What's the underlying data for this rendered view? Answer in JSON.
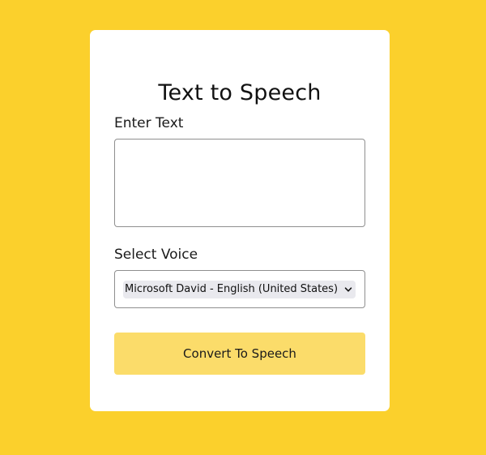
{
  "app": {
    "title": "Text to Speech"
  },
  "form": {
    "text_label": "Enter Text",
    "text_value": "",
    "voice_label": "Select Voice",
    "voice_selected": "Microsoft David - English (United States)",
    "convert_label": "Convert To Speech"
  },
  "colors": {
    "background": "#fbd02c",
    "card": "#ffffff",
    "button": "#fbdc6a",
    "border": "#8f8f8f"
  },
  "icons": {
    "select_arrow": "chevron-down-icon"
  }
}
